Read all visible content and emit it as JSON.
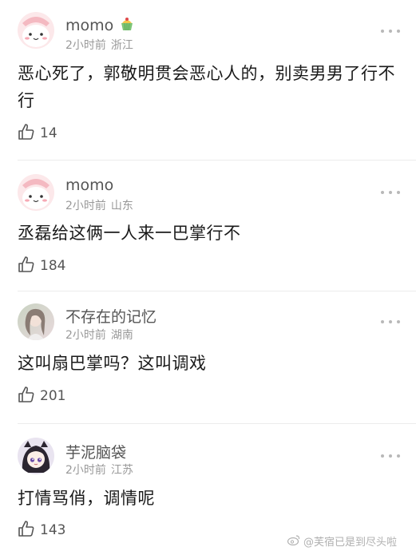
{
  "comments": [
    {
      "username": "momo",
      "time": "2小时前",
      "location": "浙江",
      "text": "恶心死了，郭敬明贯会恶心人的，别卖男男了行不行",
      "likes": "14",
      "avatar_icon": "pink-cartoon-avatar",
      "badge_icon": "cupcake-badge-icon"
    },
    {
      "username": "momo",
      "time": "2小时前",
      "location": "山东",
      "text": "丞磊给这俩一人来一巴掌行不",
      "likes": "184",
      "avatar_icon": "pink-cartoon-avatar"
    },
    {
      "username": "不存在的记忆",
      "time": "2小时前",
      "location": "湖南",
      "text": "这叫扇巴掌吗？这叫调戏",
      "likes": "201",
      "avatar_icon": "photo-avatar"
    },
    {
      "username": "芋泥脑袋",
      "time": "2小时前",
      "location": "江苏",
      "text": "打情骂俏，调情呢",
      "likes": "143",
      "avatar_icon": "anime-girl-avatar"
    }
  ],
  "watermark": "@芙宿已是到尽头啦",
  "colors": {
    "text": "#1a1a1a",
    "meta": "#999999",
    "username": "#555555"
  }
}
